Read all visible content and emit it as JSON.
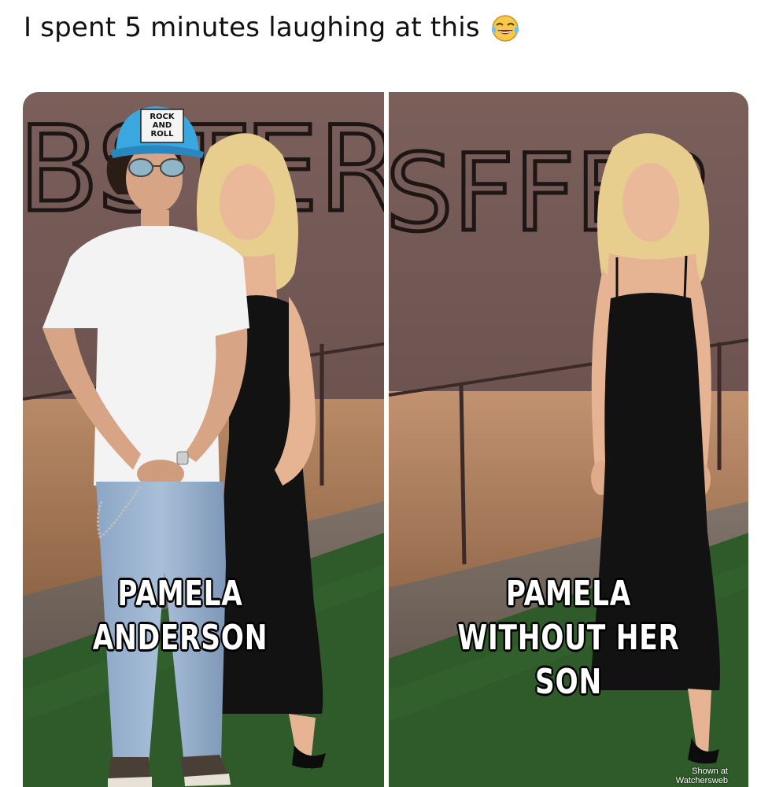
{
  "post": {
    "caption": "I spent 5 minutes laughing at this",
    "emoji": "face-with-tears-of-joy-icon"
  },
  "panels": {
    "left": {
      "wall_letters": "BSTER",
      "cap_text": [
        "ROCK",
        "AND",
        "ROLL"
      ],
      "caption_lines": [
        "PAMELA",
        "ANDERSON"
      ]
    },
    "right": {
      "wall_letters": "SFFEP",
      "caption_lines": [
        "PAMELA",
        "WITHOUT HER SON"
      ]
    }
  },
  "watermark": {
    "line1": "Shown at",
    "line2": "Watchersweb"
  },
  "colors": {
    "wall": "#6f5552",
    "carpet": "#2f5a2a",
    "dress": "#121212",
    "hair": "#e7cd8e",
    "cap": "#3aa7df"
  }
}
